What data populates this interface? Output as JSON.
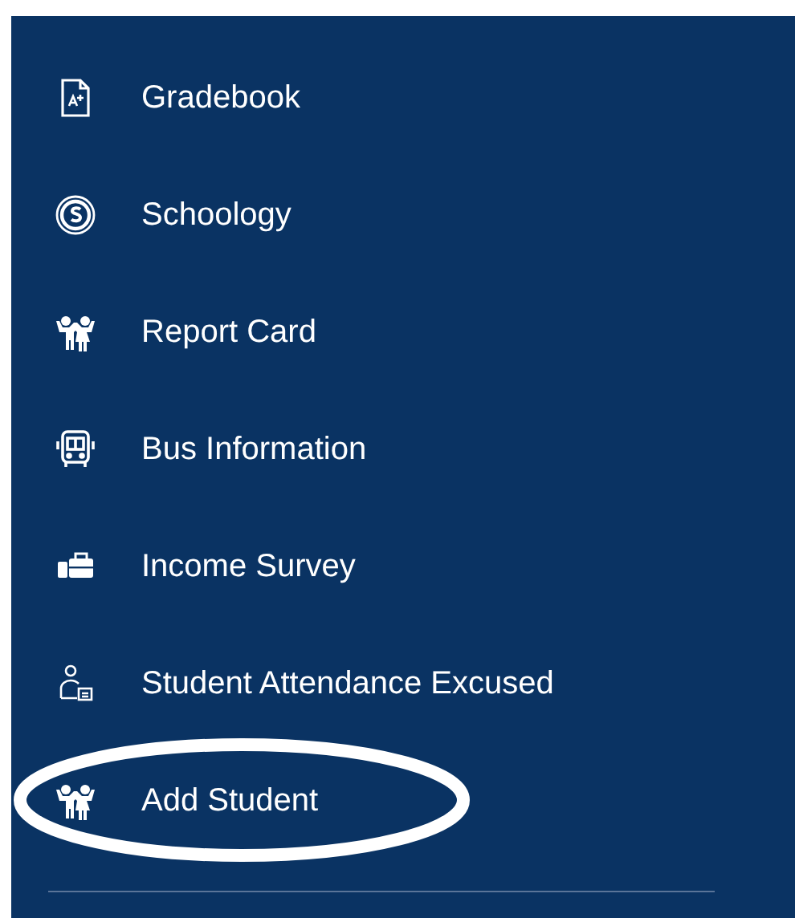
{
  "menu": {
    "items": [
      {
        "label": "Gradebook",
        "kind": "grade",
        "highlighted": false
      },
      {
        "label": "Schoology",
        "kind": "ring",
        "highlighted": false
      },
      {
        "label": "Report Card",
        "kind": "kids",
        "highlighted": false
      },
      {
        "label": "Bus Information",
        "kind": "bus",
        "highlighted": false
      },
      {
        "label": "Income Survey",
        "kind": "case",
        "highlighted": false
      },
      {
        "label": "Student Attendance Excused",
        "kind": "person",
        "highlighted": false
      },
      {
        "label": "Add Student",
        "kind": "kids",
        "highlighted": true
      }
    ]
  }
}
